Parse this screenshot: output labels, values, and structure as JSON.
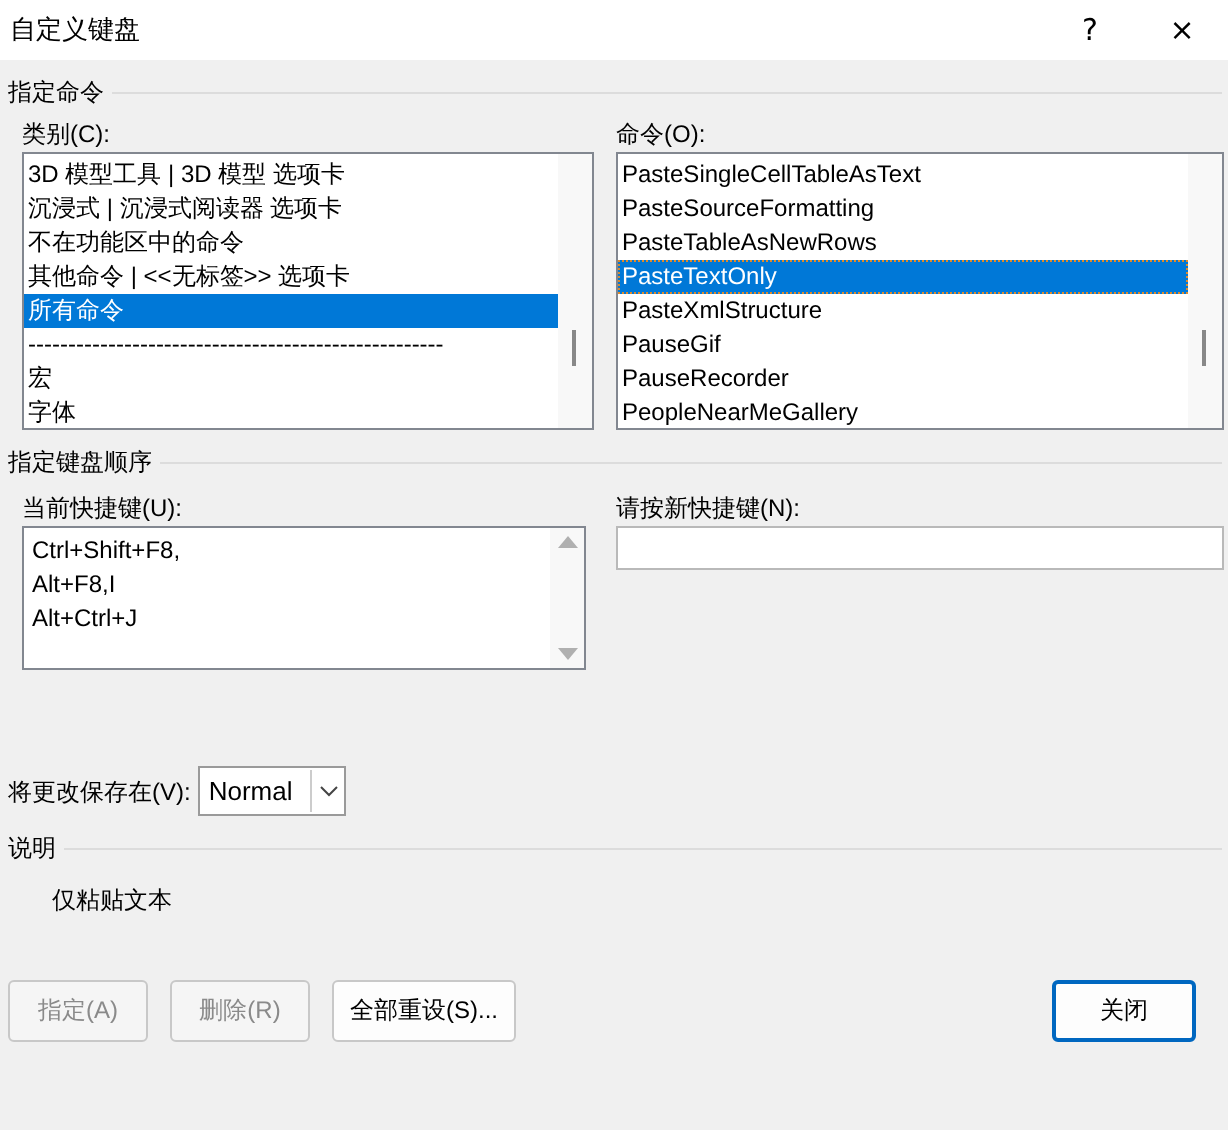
{
  "window": {
    "title": "自定义键盘",
    "help": "?",
    "close": "×"
  },
  "command_group": {
    "title": "指定命令",
    "categories": {
      "label": "类别(C):",
      "items": [
        {
          "text": "3D 模型工具 | 3D 模型 选项卡",
          "selected": false
        },
        {
          "text": "沉浸式 | 沉浸式阅读器 选项卡",
          "selected": false
        },
        {
          "text": "不在功能区中的命令",
          "selected": false
        },
        {
          "text": "其他命令 | <<无标签>> 选项卡",
          "selected": false
        },
        {
          "text": "所有命令",
          "selected": true
        },
        {
          "text": "----------------------------------------------------",
          "selected": false
        },
        {
          "text": "宏",
          "selected": false
        },
        {
          "text": "字体",
          "selected": false
        }
      ]
    },
    "commands": {
      "label": "命令(O):",
      "items": [
        {
          "text": "PasteSingleCellTableAsText",
          "selected": false
        },
        {
          "text": "PasteSourceFormatting",
          "selected": false
        },
        {
          "text": "PasteTableAsNewRows",
          "selected": false
        },
        {
          "text": "PasteTextOnly",
          "selected": true
        },
        {
          "text": "PasteXmlStructure",
          "selected": false
        },
        {
          "text": "PauseGif",
          "selected": false
        },
        {
          "text": "PauseRecorder",
          "selected": false
        },
        {
          "text": "PeopleNearMeGallery",
          "selected": false
        }
      ]
    }
  },
  "keys_group": {
    "title": "指定键盘顺序",
    "current_keys": {
      "label": "当前快捷键(U):",
      "items": [
        "Ctrl+Shift+F8,",
        "Alt+F8,I",
        "Alt+Ctrl+J"
      ]
    },
    "new_key": {
      "label": "请按新快捷键(N):"
    }
  },
  "save_in": {
    "label": "将更改保存在(V):",
    "value": "Normal"
  },
  "description": {
    "title": "说明",
    "text": "仅粘贴文本"
  },
  "buttons": [
    {
      "label": "指定(A)",
      "disabled": true,
      "default": false
    },
    {
      "label": "删除(R)",
      "disabled": true,
      "default": false
    },
    {
      "label": "全部重设(S)...",
      "disabled": false,
      "default": false
    },
    {
      "label": "关闭",
      "disabled": false,
      "default": true
    }
  ]
}
